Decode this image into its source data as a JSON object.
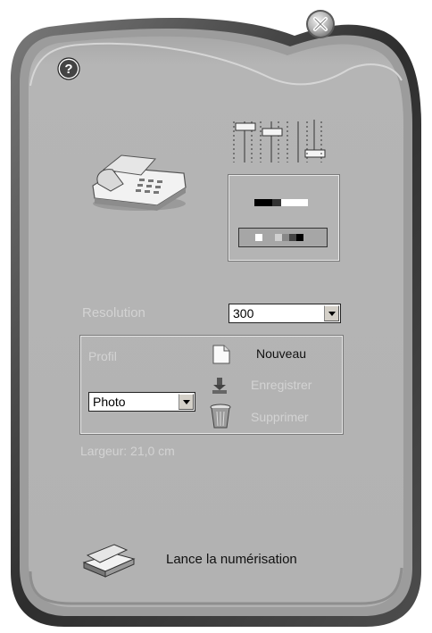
{
  "window": {
    "help_icon": "help-icon",
    "close_icon": "close-icon"
  },
  "resolution": {
    "label": "Resolution",
    "value": "300"
  },
  "profile": {
    "label": "Profil",
    "value": "Photo",
    "actions": {
      "new_label": "Nouveau",
      "save_label": "Enregistrer",
      "delete_label": "Supprimer"
    }
  },
  "width_info": "Largeur: 21,0 cm",
  "scan_button_label": "Lance la numérisation",
  "colors": {
    "panel": "#b3b3b3",
    "frame": "#4a4a4a",
    "disabled_text": "#d3d3d3"
  }
}
